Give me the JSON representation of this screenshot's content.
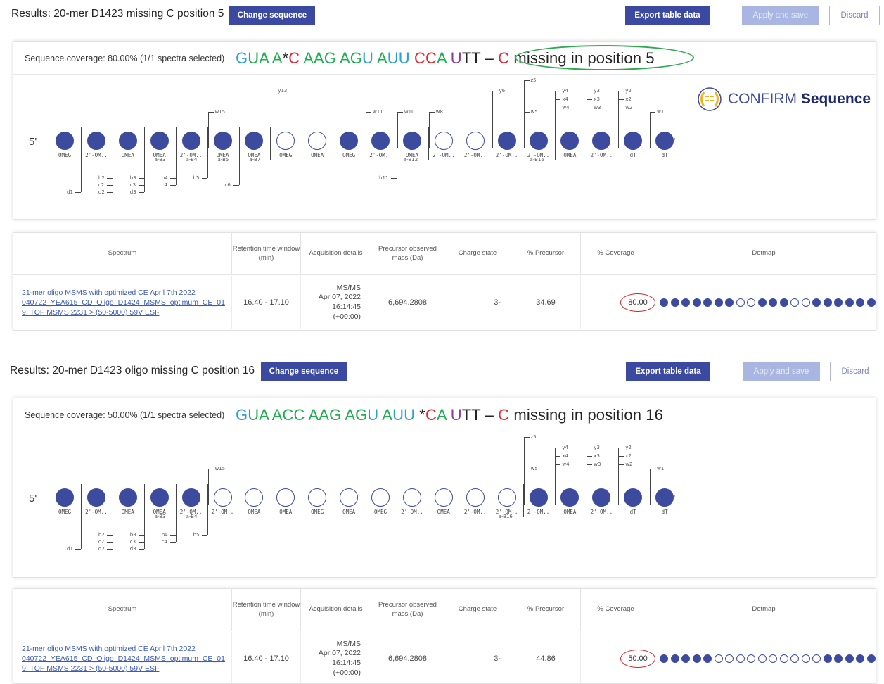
{
  "panels": [
    {
      "title": "Results: 20-mer D1423 missing C position 5",
      "change_btn": "Change sequence",
      "export_btn": "Export table data",
      "apply_btn": "Apply and save",
      "discard_btn": "Discard",
      "coverage_label": "Sequence coverage: 80.00% (1/1 spectra selected)",
      "sequence": [
        {
          "t": "G",
          "c": "b"
        },
        {
          "t": "U",
          "c": "g"
        },
        {
          "t": "A",
          "c": "g"
        },
        {
          "t": " ",
          "c": "k"
        },
        {
          "t": "A",
          "c": "g"
        },
        {
          "t": "*",
          "c": "k"
        },
        {
          "t": "C",
          "c": "r"
        },
        {
          "t": " ",
          "c": "k"
        },
        {
          "t": "AAG",
          "c": "g"
        },
        {
          "t": " ",
          "c": "k"
        },
        {
          "t": "AG",
          "c": "g"
        },
        {
          "t": "U",
          "c": "b"
        },
        {
          "t": " ",
          "c": "k"
        },
        {
          "t": "A",
          "c": "g"
        },
        {
          "t": "UU",
          "c": "b"
        },
        {
          "t": " ",
          "c": "k"
        },
        {
          "t": "CC",
          "c": "r"
        },
        {
          "t": "A",
          "c": "g"
        },
        {
          "t": " ",
          "c": "k"
        },
        {
          "t": "U",
          "c": "p"
        },
        {
          "t": "TT",
          "c": "k"
        }
      ],
      "missing_dash": " – ",
      "missing_c": "C",
      "missing_text": " missing in position 5",
      "five_prime": "5'",
      "three_prime": "3'",
      "nucleotides": [
        {
          "label": "OMEG",
          "filled": true
        },
        {
          "label": "2'-OM..",
          "filled": true
        },
        {
          "label": "OMEA",
          "filled": true
        },
        {
          "label": "OMEA",
          "filled": true
        },
        {
          "label": "2'-OM..",
          "filled": true
        },
        {
          "label": "OMEA",
          "filled": true
        },
        {
          "label": "OMEA",
          "filled": true
        },
        {
          "label": "OMEG",
          "filled": false
        },
        {
          "label": "OMEA",
          "filled": false
        },
        {
          "label": "OMEG",
          "filled": true
        },
        {
          "label": "2'-OM..",
          "filled": true
        },
        {
          "label": "OMEA",
          "filled": true
        },
        {
          "label": "2'-OM..",
          "filled": false
        },
        {
          "label": "2'-OM..",
          "filled": false
        },
        {
          "label": "2'-OM..",
          "filled": true
        },
        {
          "label": "2'-OM..",
          "filled": true
        },
        {
          "label": "OMEA",
          "filled": true
        },
        {
          "label": "2'-OM..",
          "filled": true
        },
        {
          "label": "dT",
          "filled": true
        },
        {
          "label": "dT",
          "filled": true
        }
      ],
      "logo_prefix": "CONFIRM",
      "logo_bold": "Sequence",
      "table": {
        "headers": [
          "Spectrum",
          "Retention time window (min)",
          "Acquisition details",
          "Precursor observed mass (Da)",
          "Charge state",
          "% Precursor",
          "% Coverage",
          "Dotmap"
        ],
        "row": {
          "spectrum": "21-mer oligo MSMS with optimized CE April 7th 2022 040722_YEA615_CD_Oligo_D1424_MSMS_optimum_CE_01 9: TOF MSMS 2231 > (50-5000) 59V ESI-",
          "retention": "16.40 - 17.10",
          "acq_line1": "MS/MS",
          "acq_line2": "Apr 07, 2022",
          "acq_line3": "16:14:45",
          "acq_line4": "(+00:00)",
          "mass": "6,694.2808",
          "charge": "3-",
          "precursor": "34.69",
          "coverage": "80.00",
          "dotmap": [
            1,
            1,
            1,
            1,
            1,
            1,
            1,
            0,
            0,
            1,
            1,
            1,
            0,
            0,
            1,
            1,
            1,
            1,
            1,
            1
          ]
        }
      }
    },
    {
      "title": "Results: 20-mer D1423 oligo missing C position 16",
      "change_btn": "Change sequence",
      "export_btn": "Export table data",
      "apply_btn": "Apply and save",
      "discard_btn": "Discard",
      "coverage_label": "Sequence coverage: 50.00% (1/1 spectra selected)",
      "sequence": [
        {
          "t": "G",
          "c": "b"
        },
        {
          "t": "U",
          "c": "g"
        },
        {
          "t": "A",
          "c": "g"
        },
        {
          "t": " ",
          "c": "k"
        },
        {
          "t": "ACC",
          "c": "g"
        },
        {
          "t": " ",
          "c": "k"
        },
        {
          "t": "AAG",
          "c": "g"
        },
        {
          "t": " ",
          "c": "k"
        },
        {
          "t": "AG",
          "c": "g"
        },
        {
          "t": "U",
          "c": "b"
        },
        {
          "t": " ",
          "c": "k"
        },
        {
          "t": "A",
          "c": "g"
        },
        {
          "t": "UU",
          "c": "b"
        },
        {
          "t": " ",
          "c": "k"
        },
        {
          "t": "*",
          "c": "k"
        },
        {
          "t": "C",
          "c": "r"
        },
        {
          "t": "A",
          "c": "g"
        },
        {
          "t": " ",
          "c": "k"
        },
        {
          "t": "U",
          "c": "p"
        },
        {
          "t": "TT",
          "c": "k"
        }
      ],
      "missing_dash": " – ",
      "missing_c": "C",
      "missing_text": " missing in position 16",
      "five_prime": "5'",
      "three_prime": "3'",
      "nucleotides": [
        {
          "label": "OMEG",
          "filled": true
        },
        {
          "label": "2'-OM..",
          "filled": true
        },
        {
          "label": "OMEA",
          "filled": true
        },
        {
          "label": "OMEA",
          "filled": true
        },
        {
          "label": "2'-OM..",
          "filled": true
        },
        {
          "label": "2'-OM..",
          "filled": false
        },
        {
          "label": "OMEA",
          "filled": false
        },
        {
          "label": "OMEA",
          "filled": false
        },
        {
          "label": "OMEG",
          "filled": false
        },
        {
          "label": "OMEA",
          "filled": false
        },
        {
          "label": "OMEG",
          "filled": false
        },
        {
          "label": "2'-OM..",
          "filled": false
        },
        {
          "label": "OMEA",
          "filled": false
        },
        {
          "label": "2'-OM..",
          "filled": false
        },
        {
          "label": "2'-OM..",
          "filled": false
        },
        {
          "label": "2'-OM..",
          "filled": true
        },
        {
          "label": "OMEA",
          "filled": true
        },
        {
          "label": "2'-OM..",
          "filled": true
        },
        {
          "label": "dT",
          "filled": true
        },
        {
          "label": "dT",
          "filled": true
        }
      ],
      "table": {
        "headers": [
          "Spectrum",
          "Retention time window (min)",
          "Acquisition details",
          "Precursor observed mass (Da)",
          "Charge state",
          "% Precursor",
          "% Coverage",
          "Dotmap"
        ],
        "row": {
          "spectrum": "21-mer oligo MSMS with optimized CE April 7th 2022 040722_YEA615_CD_Oligo_D1424_MSMS_optimum_CE_01 9: TOF MSMS 2231 > (50-5000) 59V ESI-",
          "retention": "16.40 - 17.10",
          "acq_line1": "MS/MS",
          "acq_line2": "Apr 07, 2022",
          "acq_line3": "16:14:45",
          "acq_line4": "(+00:00)",
          "mass": "6,694.2808",
          "charge": "3-",
          "precursor": "44.86",
          "coverage": "50.00",
          "dotmap": [
            1,
            1,
            1,
            1,
            1,
            0,
            0,
            0,
            0,
            0,
            0,
            0,
            0,
            0,
            0,
            1,
            1,
            1,
            1,
            1
          ]
        }
      }
    }
  ],
  "fragments1": {
    "bottom": [
      [
        "d1"
      ],
      [
        "b2",
        "c2",
        "d2"
      ],
      [
        "b3",
        "c3",
        "d3"
      ],
      [
        "a-B3",
        "b4",
        "c4"
      ],
      [
        "a-B4",
        "b5"
      ],
      [
        "a-B5",
        "c6"
      ],
      [
        "a-B7"
      ],
      [],
      [],
      [],
      [
        "b11"
      ],
      [
        "a-B12"
      ],
      [],
      [],
      [],
      [
        "a-B16"
      ]
    ],
    "top": [
      [],
      [],
      [],
      [],
      [
        "w15"
      ],
      [],
      [
        "y13"
      ],
      [],
      [],
      [
        "w11"
      ],
      [
        "w10"
      ],
      [
        "w8"
      ],
      [],
      [
        "y6"
      ],
      [
        "z5",
        "w5"
      ],
      [
        "y4",
        "x4",
        "w4"
      ],
      [
        "y3",
        "x3",
        "w3"
      ],
      [
        "y2",
        "x2",
        "w2"
      ],
      [
        "w1"
      ]
    ]
  },
  "fragments2": {
    "top": [
      [
        "w15"
      ],
      [
        "z5",
        "w5"
      ],
      [
        "y4",
        "x4",
        "w4"
      ],
      [
        "y3",
        "x3",
        "w3"
      ],
      [
        "y2",
        "x2",
        "w2"
      ],
      [
        "w1"
      ]
    ]
  }
}
